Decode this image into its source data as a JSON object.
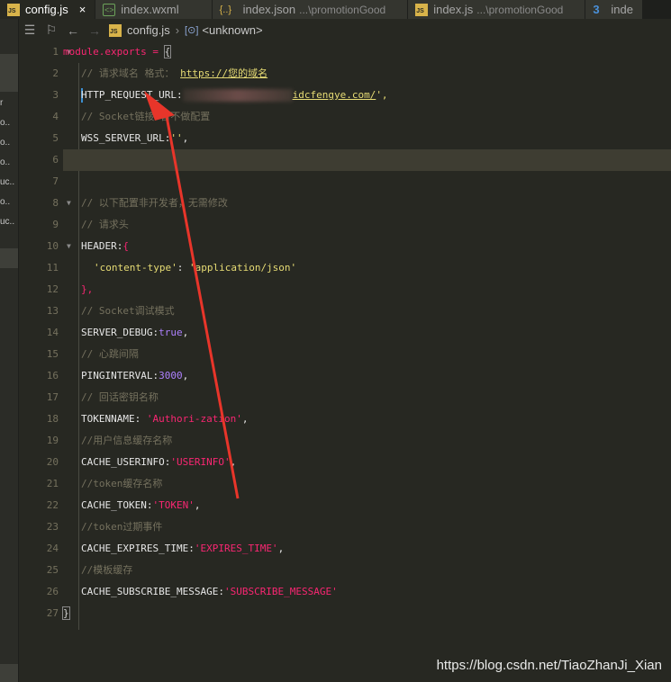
{
  "tabs": [
    {
      "icon": "js-file-icon",
      "label": "config.js",
      "desc": "",
      "active": true
    },
    {
      "icon": "wxml-file-icon",
      "label": "index.wxml",
      "desc": "",
      "active": false
    },
    {
      "icon": "json-file-icon",
      "label": "index.json",
      "desc": "...\\promotionGood",
      "active": false
    },
    {
      "icon": "js-file-icon",
      "label": "index.js",
      "desc": "...\\promotionGood",
      "active": false
    },
    {
      "icon": "css-file-icon",
      "label": "inde",
      "desc": "",
      "active": false
    }
  ],
  "tab_close_glyph": "×",
  "sidebar_fragments": [
    "r",
    "o..",
    "o..",
    "o..",
    "uc..",
    "o..",
    "uc.."
  ],
  "breadcrumb": {
    "file": "config.js",
    "symbol": "<unknown>"
  },
  "editor": {
    "line_numbers": [
      "1",
      "2",
      "3",
      "4",
      "5",
      "6",
      "7",
      "8",
      "9",
      "10",
      "11",
      "12",
      "13",
      "14",
      "15",
      "16",
      "17",
      "18",
      "19",
      "20",
      "21",
      "22",
      "23",
      "24",
      "25",
      "26",
      "27"
    ],
    "lines": {
      "l1": {
        "a": "module.exports",
        "b": " = ",
        "c": "{"
      },
      "l2": {
        "a": "// 请求域名 格式： ",
        "b": "https://您的域名"
      },
      "l3": {
        "a": "HTTP_REQUEST_URL:",
        "b": "idcfengye.com/",
        "c": "',"
      },
      "l4": {
        "a": "// Socket链接 暂不做配置"
      },
      "l5": {
        "a": "WSS_SERVER_URL:",
        "b": "''",
        "c": ","
      },
      "l8": {
        "a": "// 以下配置非开发者，无需修改"
      },
      "l9": {
        "a": "// 请求头"
      },
      "l10": {
        "a": "HEADER:",
        "b": "{"
      },
      "l11": {
        "a": "'content-type'",
        "b": ": ",
        "c": "'application/json'"
      },
      "l12": {
        "a": "},"
      },
      "l13": {
        "a": "// Socket调试模式"
      },
      "l14": {
        "a": "SERVER_DEBUG:",
        "b": "true",
        ",": ","
      },
      "l15": {
        "a": "// 心跳间隔"
      },
      "l16": {
        "a": "PINGINTERVAL:",
        "b": "3000",
        "c": ","
      },
      "l17": {
        "a": "// 回话密钥名称"
      },
      "l18": {
        "a": "TOKENNAME: ",
        "b": "'Authori-zation'",
        "c": ","
      },
      "l19": {
        "a": "//用户信息缓存名称"
      },
      "l20": {
        "a": "CACHE_USERINFO:",
        "b": "'USERINFO'",
        "c": ","
      },
      "l21": {
        "a": "//token缓存名称"
      },
      "l22": {
        "a": "CACHE_TOKEN:",
        "b": "'TOKEN'",
        "c": ","
      },
      "l23": {
        "a": "//token过期事件"
      },
      "l24": {
        "a": "CACHE_EXPIRES_TIME:",
        "b": "'EXPIRES_TIME'",
        "c": ","
      },
      "l25": {
        "a": "//模板缓存"
      },
      "l26": {
        "a": "CACHE_SUBSCRIBE_MESSAGE:",
        "b": "'SUBSCRIBE_MESSAGE'"
      },
      "l27": {
        "a": "}"
      }
    }
  },
  "colors": {
    "annotation_arrow": "#e8352a",
    "modified_marker": "#3c8fd1"
  },
  "watermark": "https://blog.csdn.net/TiaoZhanJi_Xian"
}
